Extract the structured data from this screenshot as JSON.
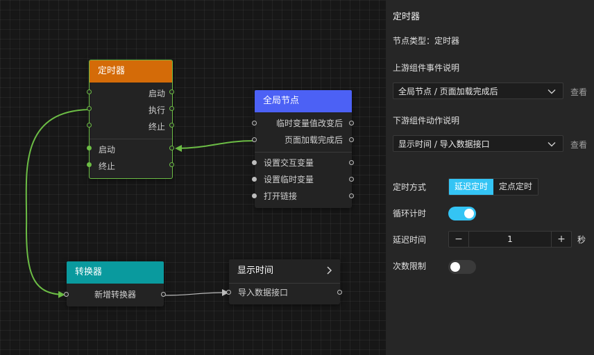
{
  "nodes": {
    "timer": {
      "title": "定时器",
      "header_color": "#d46b08",
      "outputs": [
        "启动",
        "执行",
        "终止"
      ],
      "inputs": [
        "启动",
        "终止"
      ]
    },
    "global": {
      "title": "全局节点",
      "header_color": "#4c61f5",
      "outputs": [
        "临时变量值改变后",
        "页面加载完成后"
      ],
      "inputs": [
        "设置交互变量",
        "设置临时变量",
        "打开链接"
      ]
    },
    "converter": {
      "title": "转换器",
      "header_color": "#0a9a9e",
      "rows": [
        "新增转换器"
      ]
    },
    "display": {
      "title": "显示时间",
      "rows": [
        "导入数据接口"
      ]
    }
  },
  "panel": {
    "title": "定时器",
    "node_type": "节点类型：定时器",
    "upstream_label": "上游组件事件说明",
    "upstream_value": "全局节点 / 页面加载完成后",
    "upstream_link": "查看",
    "downstream_label": "下游组件动作说明",
    "downstream_value": "显示时间 / 导入数据接口",
    "downstream_link": "查看",
    "mode_label": "定时方式",
    "mode_options": [
      "延迟定时",
      "定点定时"
    ],
    "loop_label": "循环计时",
    "loop_on": true,
    "delay_label": "延迟时间",
    "delay_minus": "−",
    "delay_value": "1",
    "delay_plus": "+",
    "delay_unit": "秒",
    "limit_label": "次数限制",
    "limit_on": false,
    "accent_color": "#34c4f4"
  }
}
